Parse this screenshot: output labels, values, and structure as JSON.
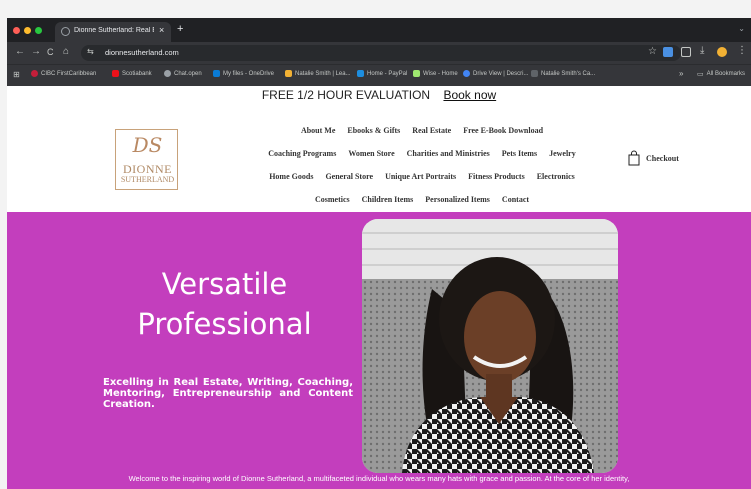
{
  "browser": {
    "tab_title": "Dionne Sutherland: Real Esta",
    "tab_close": "×",
    "new_tab": "+",
    "tab_dropdown": "⌄",
    "url": "dionnesutherland.com",
    "nav": {
      "back": "←",
      "forward": "→",
      "reload": "C",
      "home": "⌂"
    },
    "bookmarks": [
      {
        "label": "CIBC FirstCaribbean",
        "color": "#c41e3a"
      },
      {
        "label": "Scotiabank",
        "color": "#ec111a"
      },
      {
        "label": "Chat.open",
        "color": "#9aa0a6"
      },
      {
        "label": "My files - OneDrive",
        "color": "#0a7bd6"
      },
      {
        "label": "Natalie Smith | Lea...",
        "color": "#f2b134"
      },
      {
        "label": "Home - PayPal",
        "color": "#1d8ee0"
      },
      {
        "label": "Wise - Home",
        "color": "#9fe870"
      },
      {
        "label": "Drive View | Descri...",
        "color": "#4285f4"
      },
      {
        "label": "Natalie Smith's Ca...",
        "color": "#5f6368"
      }
    ],
    "bookmarks_overflow": "»",
    "all_bookmarks": "All Bookmarks",
    "colors": {
      "frame": "#202124",
      "toolbar": "#35363a"
    }
  },
  "page": {
    "promo": {
      "text": "FREE 1/2 HOUR EVALUATION",
      "link": "Book now"
    },
    "logo": {
      "monogram": "DS",
      "line1": "DIONNE",
      "line2": "SUTHERLAND"
    },
    "nav": {
      "rows": [
        [
          "About Me",
          "Ebooks & Gifts",
          "Real Estate",
          "Free E-Book Download"
        ],
        [
          "Coaching Programs",
          "Women Store",
          "Charities and Ministries",
          "Pets Items",
          "Jewelry"
        ],
        [
          "Home Goods",
          "General Store",
          "Unique Art Portraits",
          "Fitness Products",
          "Electronics"
        ],
        [
          "Cosmetics",
          "Children Items",
          "Personalized Items",
          "Contact"
        ]
      ]
    },
    "checkout": "Checkout",
    "hero": {
      "title": "Versatile Professional",
      "subtitle": "Excelling in Real Estate, Writing, Coaching, Mentoring, Entrepreneurship and Content Creation.",
      "welcome": "Welcome to the inspiring world of Dionne Sutherland, a multifaceted individual who wears many hats with grace and passion. At the core of her identity,",
      "bg_color": "#c33ebd"
    }
  }
}
